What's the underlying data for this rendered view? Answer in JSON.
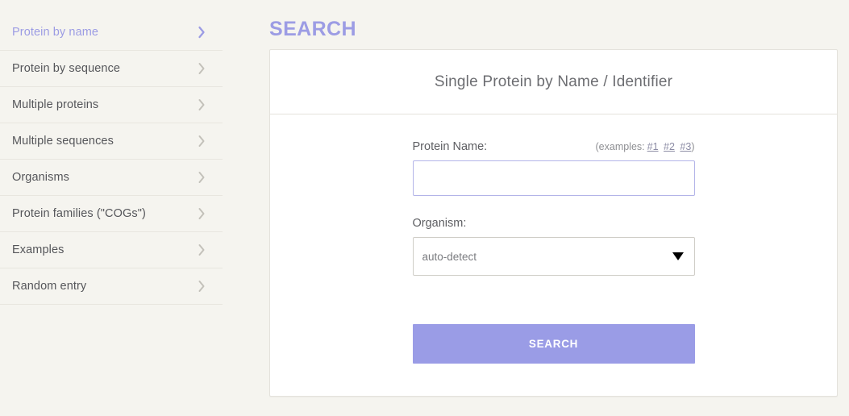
{
  "sidebar": {
    "items": [
      {
        "label": "Protein by name",
        "active": true
      },
      {
        "label": "Protein by sequence",
        "active": false
      },
      {
        "label": "Multiple proteins",
        "active": false
      },
      {
        "label": "Multiple sequences",
        "active": false
      },
      {
        "label": "Organisms",
        "active": false
      },
      {
        "label": "Protein families (\"COGs\")",
        "active": false
      },
      {
        "label": "Examples",
        "active": false
      },
      {
        "label": "Random entry",
        "active": false
      }
    ]
  },
  "main": {
    "page_title": "SEARCH",
    "card": {
      "header_title": "Single Protein by Name / Identifier",
      "protein_name_label": "Protein Name:",
      "examples_prefix": "(examples:",
      "examples_links": [
        "#1",
        "#2",
        "#3"
      ],
      "examples_suffix": ")",
      "protein_name_value": "",
      "protein_name_placeholder": "",
      "organism_label": "Organism:",
      "organism_selected": "auto-detect",
      "search_button_label": "SEARCH"
    }
  },
  "colors": {
    "accent": "#9a9ce6",
    "page_background": "#f5f4ef",
    "card_background": "#ffffff",
    "border": "#e4e2dc",
    "input_border": "#b3b4e8",
    "select_border": "#cfcdc7",
    "text": "#55565a"
  }
}
